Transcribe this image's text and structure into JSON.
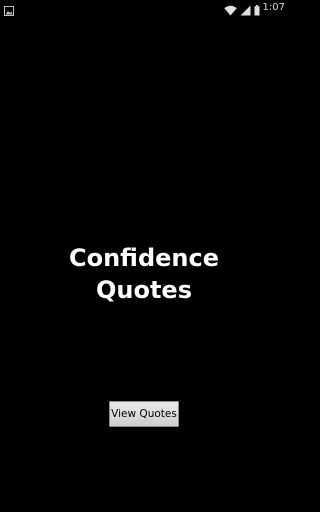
{
  "status_bar": {
    "time": "1:07",
    "icons": [
      "gallery-icon",
      "wifi-icon",
      "signal-icon",
      "battery-icon"
    ]
  },
  "main": {
    "title_line1": "Confidence",
    "title_line2": "Quotes",
    "view_button_label": "View Quotes"
  },
  "colors": {
    "background": "#000000",
    "text": "#ffffff",
    "button_bg": "#dcdcdc"
  }
}
